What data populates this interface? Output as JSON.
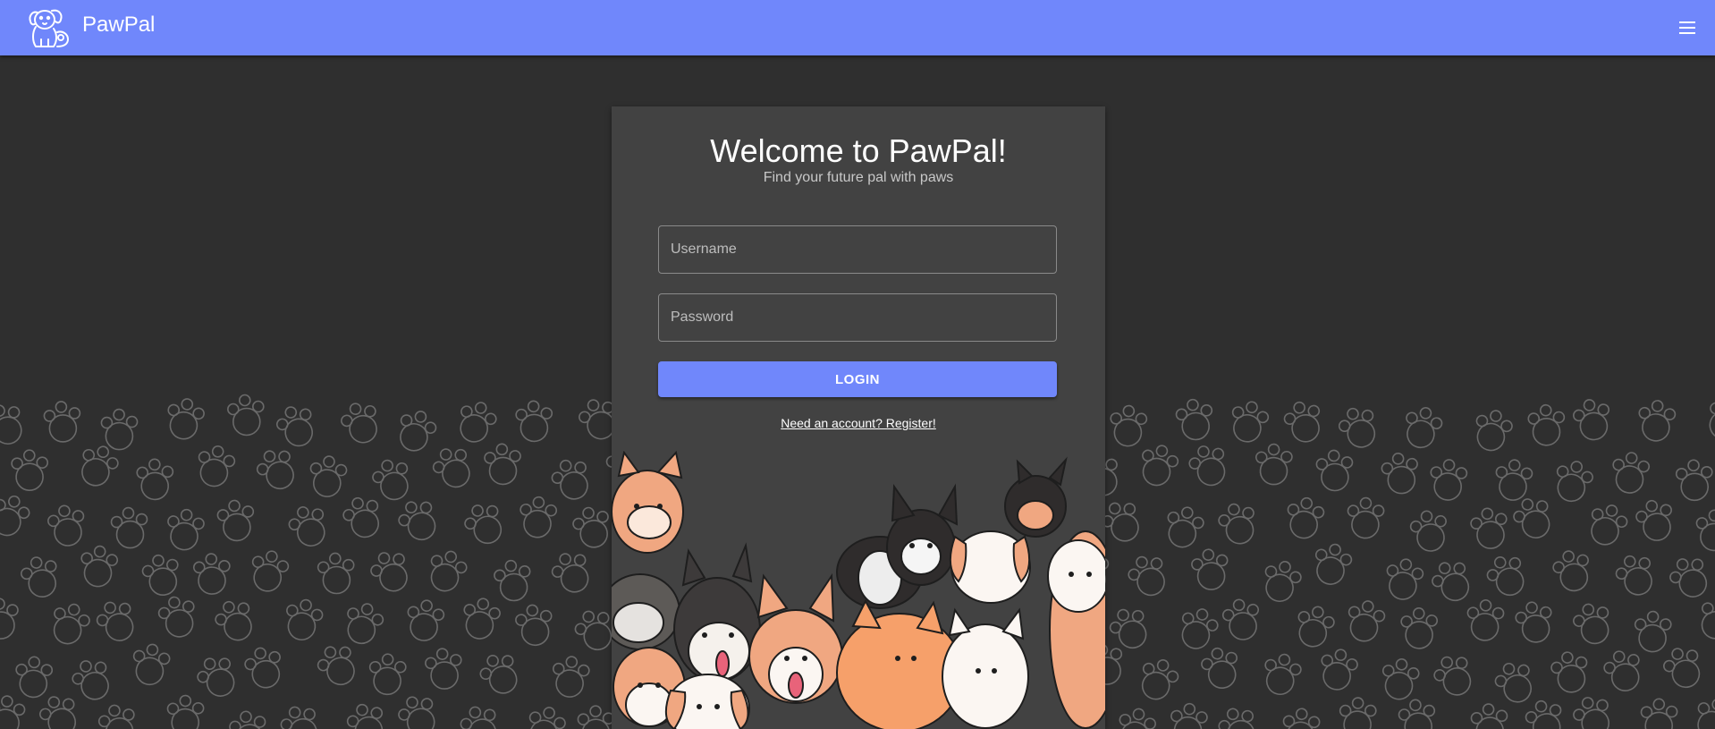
{
  "app_bar": {
    "brand": "PawPal",
    "background_color": "#7087fb",
    "logo_icon": "dog-logo-icon",
    "menu_icon": "hamburger-menu-icon"
  },
  "login_card": {
    "title": "Welcome to PawPal!",
    "subtitle": "Find your future pal with paws",
    "username_placeholder": "Username",
    "password_placeholder": "Password",
    "login_label": "LOGIN",
    "register_link": "Need an account? Register!",
    "illustration": "group-of-dogs-illustration"
  },
  "colors": {
    "page_background": "#2f2f2f",
    "card_background": "#424242",
    "accent": "#7087fb"
  }
}
